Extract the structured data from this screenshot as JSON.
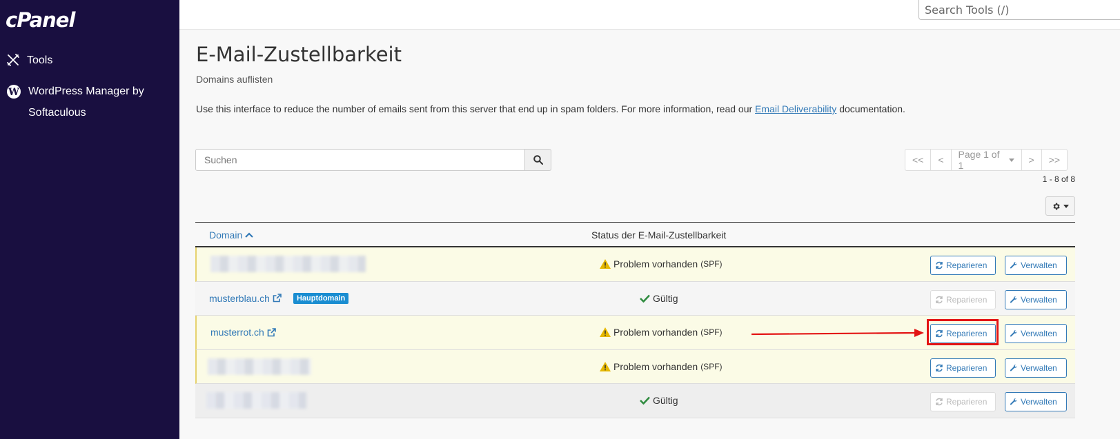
{
  "sidebar": {
    "logo": "cPanel",
    "items": [
      {
        "label": "Tools",
        "icon": "tools-icon"
      },
      {
        "label": "WordPress Manager by Softaculous",
        "icon": "wordpress-icon"
      }
    ]
  },
  "topbar": {
    "search_placeholder": "Search Tools (/)"
  },
  "page": {
    "title": "E-Mail-Zustellbarkeit",
    "subtitle": "Domains auflisten",
    "desc_before": "Use this interface to reduce the number of emails sent from this server that end up in spam folders. For more information, read our ",
    "desc_link": "Email Deliverability",
    "desc_after": " documentation."
  },
  "search": {
    "placeholder": "Suchen"
  },
  "pager": {
    "first": "<<",
    "prev": "<",
    "page": "Page 1 of 1",
    "next": ">",
    "last": ">>",
    "count": "1 - 8 of 8"
  },
  "table": {
    "col_domain": "Domain",
    "col_status": "Status der E-Mail-Zustellbarkeit",
    "rows": [
      {
        "domain": "",
        "status": "Problem vorhanden",
        "detail": "(SPF)",
        "repair": "Reparieren",
        "manage": "Verwalten"
      },
      {
        "domain": "musterblau.ch",
        "badge": "Hauptdomain",
        "status": "Gültig",
        "repair": "Reparieren",
        "manage": "Verwalten"
      },
      {
        "domain": "musterrot.ch",
        "status": "Problem vorhanden",
        "detail": "(SPF)",
        "repair": "Reparieren",
        "manage": "Verwalten"
      },
      {
        "domain": "",
        "status": "Problem vorhanden",
        "detail": "(SPF)",
        "repair": "Reparieren",
        "manage": "Verwalten"
      },
      {
        "domain": "",
        "status": "Gültig",
        "repair": "Reparieren",
        "manage": "Verwalten"
      }
    ]
  },
  "colors": {
    "sidebar_bg": "#190f40",
    "link": "#337ab7",
    "warning": "#e6b800",
    "success": "#2e8b3e",
    "badge": "#1a8dd1",
    "highlight": "#e31414"
  }
}
